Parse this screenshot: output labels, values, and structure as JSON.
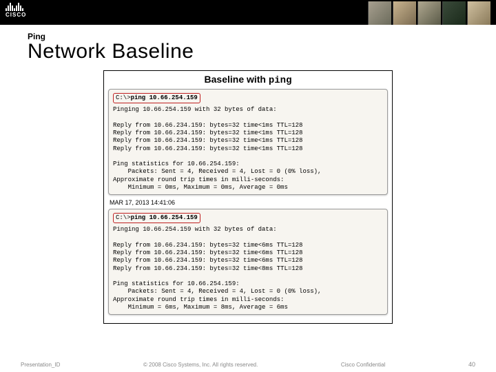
{
  "logo_text": "CISCO",
  "overline": "Ping",
  "title": "Network Baseline",
  "panel_title_1": "Baseline with ",
  "panel_title_mono": "ping",
  "term1": {
    "prompt": "C:\\>",
    "cmd": "ping 10.66.254.159",
    "body": "Pinging 10.66.254.159 with 32 bytes of data:\n\nReply from 10.66.234.159: bytes=32 time<1ms TTL=128\nReply from 10.66.234.159: bytes=32 time<1ms TTL=128\nReply from 10.66.234.159: bytes=32 time<1ms TTL=128\nReply from 10.66.234.159: bytes=32 time<1ms TTL=128\n\nPing statistics for 10.66.254.159:\n    Packets: Sent = 4, Received = 4, Lost = 0 (0% loss),\nApproximate round trip times in milli-seconds:\n    Minimum = 0ms, Maximum = 0ms, Average = 0ms"
  },
  "timestamp": "MAR 17, 2013 14:41:06",
  "term2": {
    "prompt": "C:\\>",
    "cmd": "ping 10.66.254.159",
    "body": "Pinging 10.66.254.159 with 32 bytes of data:\n\nReply from 10.66.234.159: bytes=32 time<6ms TTL=128\nReply from 10.66.234.159: bytes=32 time<6ms TTL=128\nReply from 10.66.234.159: bytes=32 time<6ms TTL=128\nReply from 10.66.234.159: bytes=32 time<8ms TTL=128\n\nPing statistics for 10.66.254.159:\n    Packets: Sent = 4, Received = 4, Lost = 0 (0% loss),\nApproximate round trip times in milli-seconds:\n    Minimum = 6ms, Maximum = 8ms, Average = 6ms"
  },
  "footer": {
    "left": "Presentation_ID",
    "center": "© 2008 Cisco Systems, Inc. All rights reserved.",
    "right": "Cisco Confidential",
    "page": "40"
  }
}
